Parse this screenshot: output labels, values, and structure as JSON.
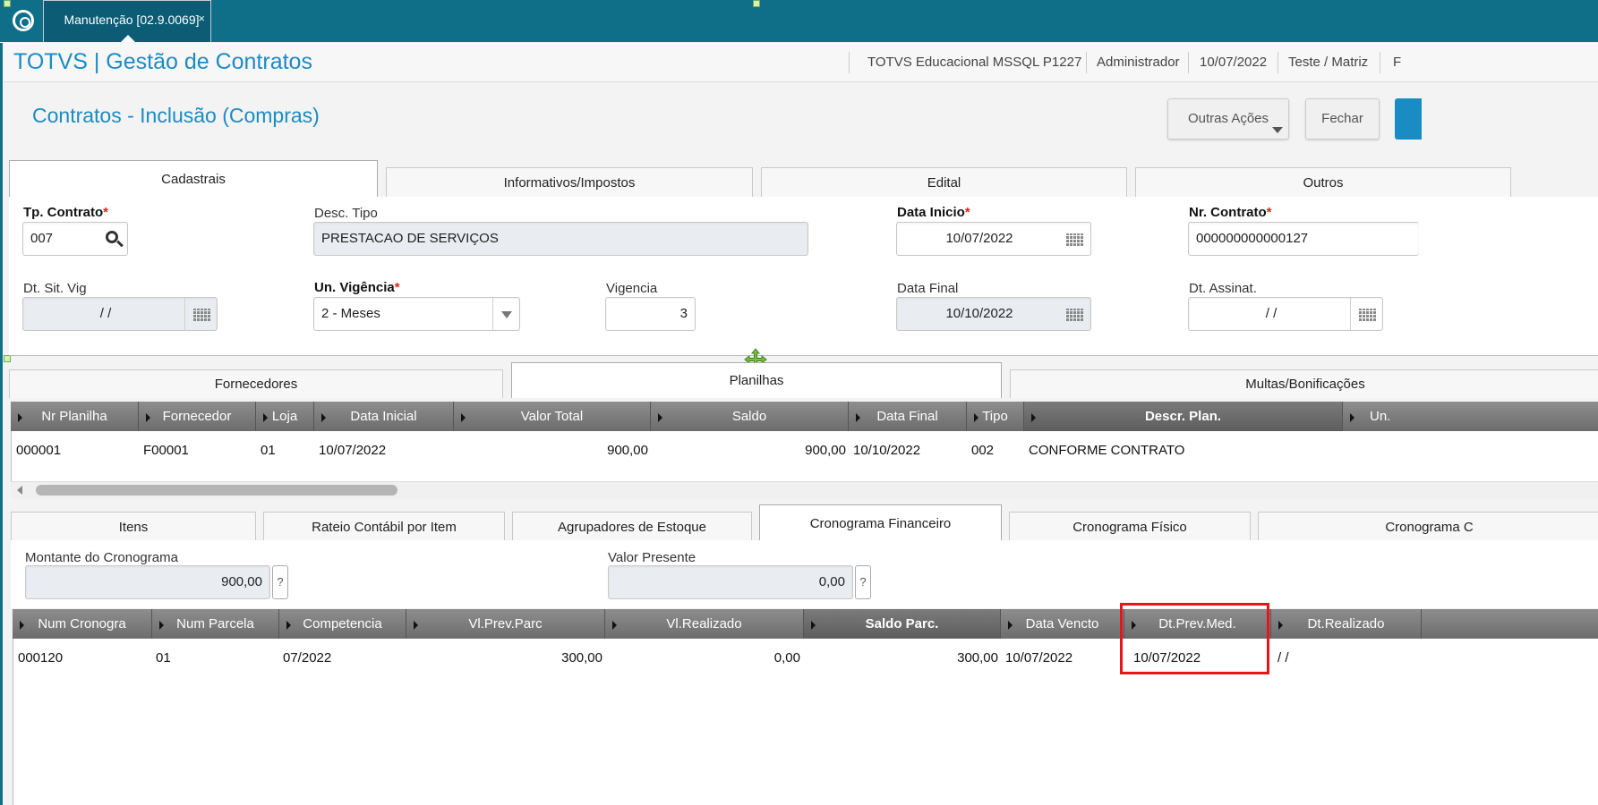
{
  "window": {
    "tab_label": "Manutenção [02.9.0069]",
    "tab_close": "×"
  },
  "header": {
    "app_title": "TOTVS | Gestão de Contratos",
    "environment": "TOTVS Educacional MSSQL P1227",
    "user": "Administrador",
    "date": "10/07/2022",
    "branch": "Teste / Matriz",
    "extra": "F"
  },
  "page": {
    "title": "Contratos - Inclusão (Compras)",
    "other_actions": "Outras Ações",
    "close": "Fechar"
  },
  "main_tabs": [
    "Cadastrais",
    "Informativos/Impostos",
    "Edital",
    "Outros"
  ],
  "form": {
    "tp_contrato_label": "Tp. Contrato",
    "tp_contrato_value": "007",
    "desc_tipo_label": "Desc. Tipo",
    "desc_tipo_value": "PRESTACAO DE SERVIÇOS",
    "data_inicio_label": "Data Inicio",
    "data_inicio_value": "10/07/2022",
    "nr_contrato_label": "Nr. Contrato",
    "nr_contrato_value": "000000000000127",
    "dt_sit_vig_label": "Dt. Sit. Vig",
    "dt_sit_vig_value": "/ /",
    "un_vigencia_label": "Un. Vigência",
    "un_vigencia_value": "2 - Meses",
    "vigencia_label": "Vigencia",
    "vigencia_value": "3",
    "data_final_label": "Data Final",
    "data_final_value": "10/10/2022",
    "dt_assinat_label": "Dt. Assinat.",
    "dt_assinat_value": "/ /",
    "required_mark": "*"
  },
  "sub_tabs": [
    "Fornecedores",
    "Planilhas",
    "Multas/Bonificações"
  ],
  "planilhas": {
    "columns": [
      "Nr Planilha",
      "Fornecedor",
      "Loja",
      "Data Inicial",
      "Valor Total",
      "Saldo",
      "Data Final",
      "Tipo",
      "Descr. Plan.",
      "Un."
    ],
    "rows": [
      [
        "000001",
        "F00001",
        "01",
        "10/07/2022",
        "900,00",
        "900,00",
        "10/10/2022",
        "002",
        "CONFORME CONTRATO",
        ""
      ]
    ]
  },
  "detail_tabs": [
    "Itens",
    "Rateio Contábil por Item",
    "Agrupadores de Estoque",
    "Cronograma Financeiro",
    "Cronograma Físico",
    "Cronograma C"
  ],
  "cronograma": {
    "montante_label": "Montante do Cronograma",
    "montante_value": "900,00",
    "valor_presente_label": "Valor Presente",
    "valor_presente_value": "0,00",
    "help_symbol": "?",
    "columns": [
      "Num Cronogra",
      "Num Parcela",
      "Competencia",
      "Vl.Prev.Parc",
      "Vl.Realizado",
      "Saldo Parc.",
      "Data Vencto",
      "Dt.Prev.Med.",
      "Dt.Realizado"
    ],
    "rows": [
      [
        "000120",
        "01",
        "07/2022",
        "300,00",
        "0,00",
        "300,00",
        "10/07/2022",
        "10/07/2022",
        "/ /"
      ]
    ]
  },
  "colors": {
    "topbar": "#0f6f89",
    "accent": "#1a8cc4",
    "highlight_box": "#e8141a",
    "required": "#e02020"
  },
  "icons": [
    "totvs-logo-icon",
    "close-icon",
    "search-icon",
    "calendar-icon",
    "dropdown-arrow-icon",
    "move-icon",
    "column-marker-icon",
    "scroll-left-icon"
  ]
}
